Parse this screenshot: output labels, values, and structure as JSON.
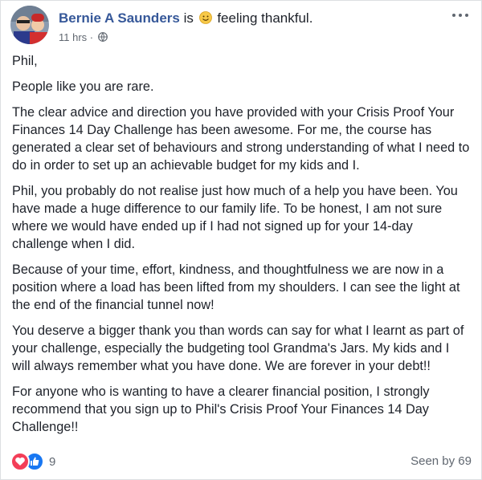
{
  "post": {
    "author": "Bernie A Saunders",
    "feeling_prefix": "is",
    "feeling_text": "feeling thankful.",
    "timestamp": "11 hrs",
    "paragraphs": [
      "Phil,",
      "People like you are rare.",
      "The clear advice and direction you have provided with your Crisis Proof Your Finances 14 Day Challenge has been awesome. For me, the course has generated a clear set of behaviours and strong understanding of what I need to do in order to set up an achievable budget for my kids and I.",
      "Phil, you probably do not realise just how much of a help you have been. You have made a huge difference to our family life. To be honest, I am not sure where we would have ended up if I had not signed up for your 14-day challenge when I did.",
      "Because of your time, effort, kindness, and thoughtfulness we are now in a position where a load has been lifted from my shoulders. I can see the light at the end of the financial tunnel now!",
      "You deserve a bigger thank you than words can say for what I learnt as part of your challenge, especially the budgeting tool Grandma's Jars. My kids and I will always remember what you have done. We are forever in your debt!!",
      "For anyone who is wanting to have a clearer financial position, I strongly recommend that you sign up to Phil's Crisis Proof Your Finances 14 Day Challenge!!"
    ]
  },
  "footer": {
    "reaction_count": "9",
    "seen_by": "Seen by 69"
  },
  "colors": {
    "author_link": "#365899",
    "meta_text": "#606770",
    "love_reaction": "#f33e58",
    "like_reaction": "#1877f2"
  },
  "icons": {
    "avatar": "avatar",
    "feeling": "smiling-face-icon",
    "privacy": "globe-icon",
    "more": "more-options-icon",
    "reactions": [
      "love-reaction-icon",
      "like-reaction-icon"
    ]
  }
}
